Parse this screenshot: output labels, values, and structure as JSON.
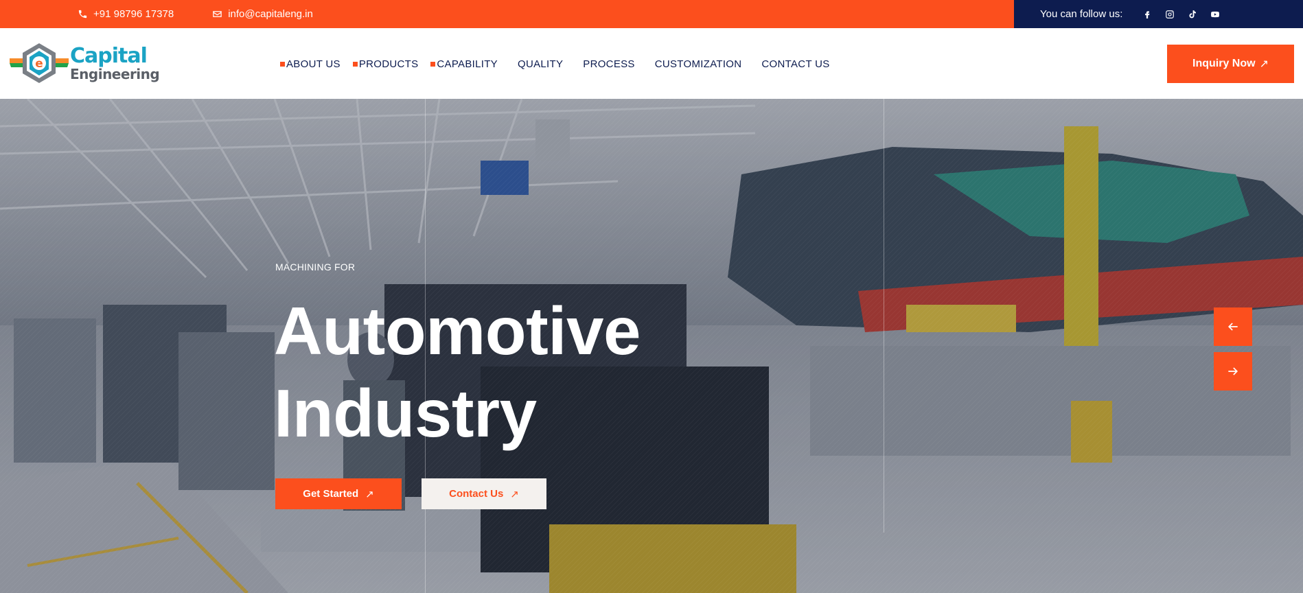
{
  "colors": {
    "accent": "#fc4f1d",
    "navy": "#0d1c4f",
    "logo_blue": "#1ba3c4",
    "logo_gray": "#5a5f67"
  },
  "topbar": {
    "phone": "+91 98796 17378",
    "email": "info@capitaleng.in",
    "follow_label": "You can follow us:",
    "social_icons": [
      "facebook-icon",
      "instagram-icon",
      "tiktok-icon",
      "youtube-icon"
    ]
  },
  "logo": {
    "line1": "Capital",
    "line2": "Engineering"
  },
  "nav": {
    "items": [
      {
        "label": "ABOUT US"
      },
      {
        "label": "PRODUCTS"
      },
      {
        "label": "CAPABILITY"
      },
      {
        "label": "QUALITY"
      },
      {
        "label": "PROCESS"
      },
      {
        "label": "CUSTOMIZATION"
      },
      {
        "label": "CONTACT US"
      }
    ]
  },
  "header": {
    "cta_label": "Inquiry Now",
    "cta_arrow": "↗"
  },
  "hero": {
    "eyebrow": "MACHINING FOR",
    "title_line1": "Automotive",
    "title_line2": "Industry",
    "primary_label": "Get Started",
    "secondary_label": "Contact Us",
    "arrow": "↗",
    "slider_icons": [
      "arrow-left-icon",
      "arrow-right-icon"
    ]
  }
}
